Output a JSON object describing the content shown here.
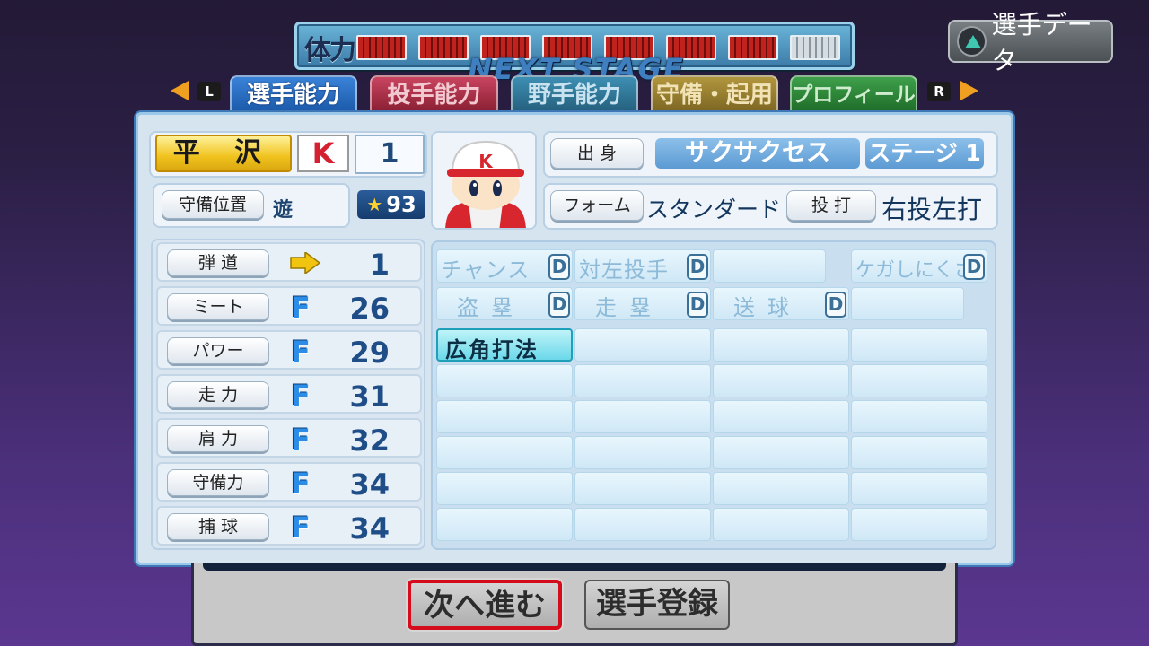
{
  "stamina": {
    "label": "体力",
    "full_gauges": 7,
    "partial_fraction": 0.4
  },
  "stage_banner": "NEXT STAGE",
  "player_data_button": {
    "label": "選手データ",
    "icon": "triangle-icon"
  },
  "nav": {
    "left_key": "L",
    "right_key": "R"
  },
  "tabs": [
    {
      "label": "選手能力",
      "active": true
    },
    {
      "label": "投手能力"
    },
    {
      "label": "野手能力"
    },
    {
      "label": "守備・起用"
    },
    {
      "label": "プロフィール"
    }
  ],
  "player": {
    "name": "平 沢",
    "team_logo": "K",
    "number": "1",
    "position_label": "守備位置",
    "position": "遊",
    "overall": "93",
    "origin_label": "出 身",
    "origin": "サクサクセス",
    "stage": "ステージ 1",
    "form_label": "フォーム",
    "form": "スタンダード 1",
    "throw_bat_label": "投 打",
    "throw_bat": "右投左打",
    "cap_letter": "K"
  },
  "stats": [
    {
      "label": "弾 道",
      "grade": "arrow-right-icon",
      "value": "1"
    },
    {
      "label": "ミート",
      "grade": "F",
      "value": "26"
    },
    {
      "label": "パワー",
      "grade": "F",
      "value": "29"
    },
    {
      "label": "走 力",
      "grade": "F",
      "value": "31"
    },
    {
      "label": "肩 力",
      "grade": "F",
      "value": "32"
    },
    {
      "label": "守備力",
      "grade": "F",
      "value": "34"
    },
    {
      "label": "捕 球",
      "grade": "F",
      "value": "34"
    }
  ],
  "abilities": {
    "rank_abilities": [
      {
        "label": "チャンス",
        "rank": "D"
      },
      {
        "label": "対左投手",
        "rank": "D"
      },
      {
        "label": "",
        "rank": ""
      },
      {
        "label": "ケガしにくさ",
        "rank": "D"
      },
      {
        "label": "盗塁",
        "rank": "D"
      },
      {
        "label": "走塁",
        "rank": "D"
      },
      {
        "label": "送球",
        "rank": "D"
      },
      {
        "label": "",
        "rank": ""
      }
    ],
    "special": [
      "広角打法"
    ]
  },
  "buttons": {
    "next": "次へ進む",
    "register": "選手登録"
  },
  "colors": {
    "accent_red": "#d40c1c",
    "grade_blue": "#2b8de8",
    "name_gold": "#f0c21d"
  }
}
